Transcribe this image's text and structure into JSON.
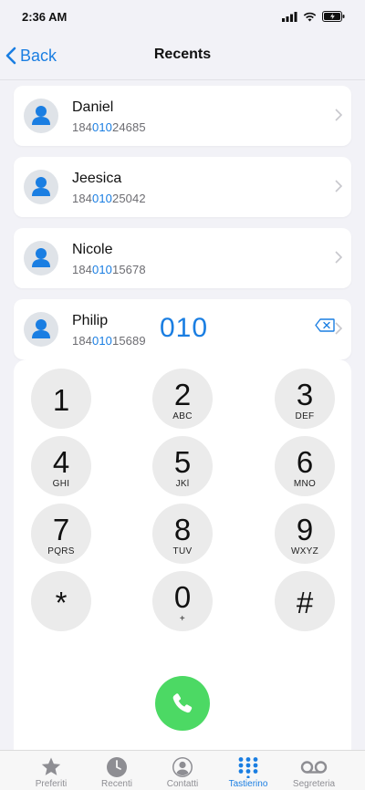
{
  "status": {
    "time": "2:36 AM"
  },
  "nav": {
    "back_label": "Back",
    "title": "Recents"
  },
  "contacts": [
    {
      "name": "Daniel",
      "num_pre": "184",
      "num_hl": "010",
      "num_post": "24685"
    },
    {
      "name": "Jeesica",
      "num_pre": "184",
      "num_hl": "010",
      "num_post": "25042"
    },
    {
      "name": "Nicole",
      "num_pre": "184",
      "num_hl": "010",
      "num_post": "15678"
    },
    {
      "name": "Philip",
      "num_pre": "184",
      "num_hl": "010",
      "num_post": "15689"
    }
  ],
  "dialer": {
    "typed": "010"
  },
  "keys": [
    {
      "digit": "1",
      "letters": ""
    },
    {
      "digit": "2",
      "letters": "ABC"
    },
    {
      "digit": "3",
      "letters": "DEF"
    },
    {
      "digit": "4",
      "letters": "GHI"
    },
    {
      "digit": "5",
      "letters": "JKl"
    },
    {
      "digit": "6",
      "letters": "MNO"
    },
    {
      "digit": "7",
      "letters": "PQRS"
    },
    {
      "digit": "8",
      "letters": "TUV"
    },
    {
      "digit": "9",
      "letters": "WXYZ"
    },
    {
      "digit": "*",
      "letters": ""
    },
    {
      "digit": "0",
      "letters": "+"
    },
    {
      "digit": "#",
      "letters": ""
    }
  ],
  "tabs": [
    {
      "label": "Preferiti",
      "icon": "star-icon"
    },
    {
      "label": "Recenti",
      "icon": "clock-icon"
    },
    {
      "label": "Contatti",
      "icon": "contact-icon"
    },
    {
      "label": "Tastierino",
      "icon": "keypad-icon",
      "active": true
    },
    {
      "label": "Segreteria",
      "icon": "voicemail-icon"
    }
  ],
  "colors": {
    "accent": "#1a7ee2",
    "call": "#4cd964",
    "key_bg": "#ebebeb",
    "background": "#f2f2f7"
  }
}
